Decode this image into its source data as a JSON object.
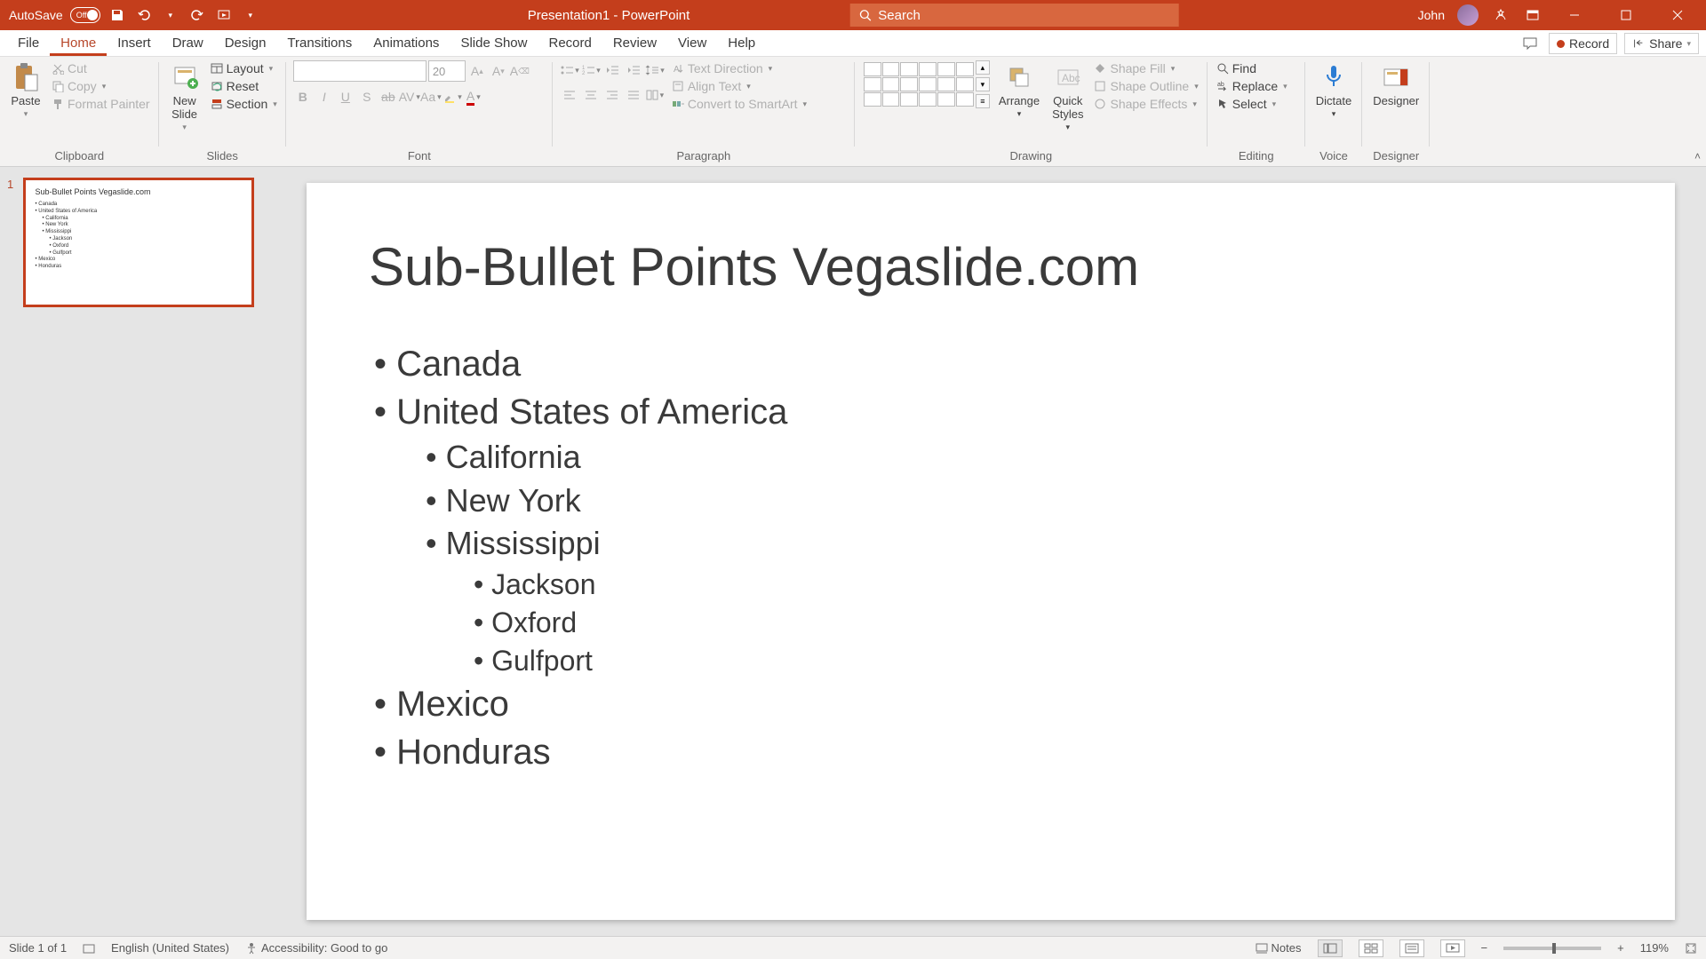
{
  "titlebar": {
    "autosave_label": "AutoSave",
    "autosave_state": "Off",
    "doc_title": "Presentation1 - PowerPoint",
    "search_placeholder": "Search",
    "user_name": "John"
  },
  "tabs": {
    "file": "File",
    "home": "Home",
    "insert": "Insert",
    "draw": "Draw",
    "design": "Design",
    "transitions": "Transitions",
    "animations": "Animations",
    "slideshow": "Slide Show",
    "record": "Record",
    "review": "Review",
    "view": "View",
    "help": "Help",
    "record_btn": "Record",
    "share_btn": "Share"
  },
  "ribbon": {
    "clipboard": {
      "paste": "Paste",
      "cut": "Cut",
      "copy": "Copy",
      "format_painter": "Format Painter",
      "label": "Clipboard"
    },
    "slides": {
      "new_slide": "New\nSlide",
      "layout": "Layout",
      "reset": "Reset",
      "section": "Section",
      "label": "Slides"
    },
    "font": {
      "size_placeholder": "20",
      "label": "Font"
    },
    "paragraph": {
      "text_direction": "Text Direction",
      "align_text": "Align Text",
      "convert_smartart": "Convert to SmartArt",
      "label": "Paragraph"
    },
    "drawing": {
      "arrange": "Arrange",
      "quick_styles": "Quick\nStyles",
      "shape_fill": "Shape Fill",
      "shape_outline": "Shape Outline",
      "shape_effects": "Shape Effects",
      "label": "Drawing"
    },
    "editing": {
      "find": "Find",
      "replace": "Replace",
      "select": "Select",
      "label": "Editing"
    },
    "voice": {
      "dictate": "Dictate",
      "label": "Voice"
    },
    "designer": {
      "designer": "Designer",
      "label": "Designer"
    }
  },
  "slide": {
    "number": "1",
    "title": "Sub-Bullet Points Vegaslide.com",
    "items": {
      "canada": "Canada",
      "usa": "United States of America",
      "california": "California",
      "newyork": "New York",
      "mississippi": "Mississippi",
      "jackson": "Jackson",
      "oxford": "Oxford",
      "gulfport": "Gulfport",
      "mexico": "Mexico",
      "honduras": "Honduras"
    }
  },
  "status": {
    "slide_info": "Slide 1 of 1",
    "language": "English (United States)",
    "accessibility": "Accessibility: Good to go",
    "notes": "Notes",
    "zoom": "119%"
  }
}
